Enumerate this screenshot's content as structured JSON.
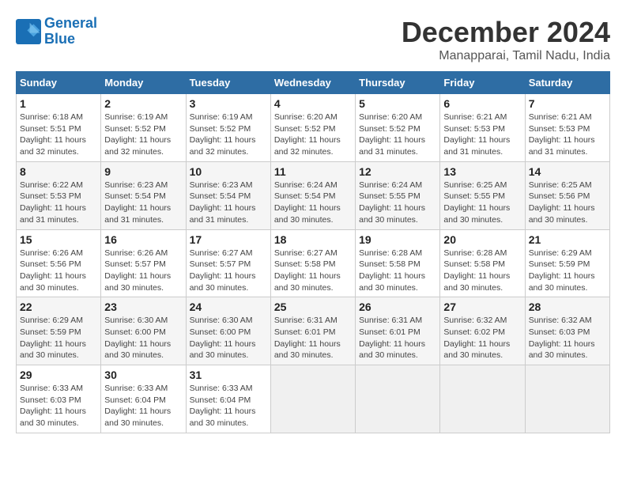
{
  "header": {
    "logo_line1": "General",
    "logo_line2": "Blue",
    "title": "December 2024",
    "subtitle": "Manapparai, Tamil Nadu, India"
  },
  "days_of_week": [
    "Sunday",
    "Monday",
    "Tuesday",
    "Wednesday",
    "Thursday",
    "Friday",
    "Saturday"
  ],
  "weeks": [
    [
      {
        "day": "1",
        "detail": "Sunrise: 6:18 AM\nSunset: 5:51 PM\nDaylight: 11 hours\nand 32 minutes."
      },
      {
        "day": "2",
        "detail": "Sunrise: 6:19 AM\nSunset: 5:52 PM\nDaylight: 11 hours\nand 32 minutes."
      },
      {
        "day": "3",
        "detail": "Sunrise: 6:19 AM\nSunset: 5:52 PM\nDaylight: 11 hours\nand 32 minutes."
      },
      {
        "day": "4",
        "detail": "Sunrise: 6:20 AM\nSunset: 5:52 PM\nDaylight: 11 hours\nand 32 minutes."
      },
      {
        "day": "5",
        "detail": "Sunrise: 6:20 AM\nSunset: 5:52 PM\nDaylight: 11 hours\nand 31 minutes."
      },
      {
        "day": "6",
        "detail": "Sunrise: 6:21 AM\nSunset: 5:53 PM\nDaylight: 11 hours\nand 31 minutes."
      },
      {
        "day": "7",
        "detail": "Sunrise: 6:21 AM\nSunset: 5:53 PM\nDaylight: 11 hours\nand 31 minutes."
      }
    ],
    [
      {
        "day": "8",
        "detail": "Sunrise: 6:22 AM\nSunset: 5:53 PM\nDaylight: 11 hours\nand 31 minutes."
      },
      {
        "day": "9",
        "detail": "Sunrise: 6:23 AM\nSunset: 5:54 PM\nDaylight: 11 hours\nand 31 minutes."
      },
      {
        "day": "10",
        "detail": "Sunrise: 6:23 AM\nSunset: 5:54 PM\nDaylight: 11 hours\nand 31 minutes."
      },
      {
        "day": "11",
        "detail": "Sunrise: 6:24 AM\nSunset: 5:54 PM\nDaylight: 11 hours\nand 30 minutes."
      },
      {
        "day": "12",
        "detail": "Sunrise: 6:24 AM\nSunset: 5:55 PM\nDaylight: 11 hours\nand 30 minutes."
      },
      {
        "day": "13",
        "detail": "Sunrise: 6:25 AM\nSunset: 5:55 PM\nDaylight: 11 hours\nand 30 minutes."
      },
      {
        "day": "14",
        "detail": "Sunrise: 6:25 AM\nSunset: 5:56 PM\nDaylight: 11 hours\nand 30 minutes."
      }
    ],
    [
      {
        "day": "15",
        "detail": "Sunrise: 6:26 AM\nSunset: 5:56 PM\nDaylight: 11 hours\nand 30 minutes."
      },
      {
        "day": "16",
        "detail": "Sunrise: 6:26 AM\nSunset: 5:57 PM\nDaylight: 11 hours\nand 30 minutes."
      },
      {
        "day": "17",
        "detail": "Sunrise: 6:27 AM\nSunset: 5:57 PM\nDaylight: 11 hours\nand 30 minutes."
      },
      {
        "day": "18",
        "detail": "Sunrise: 6:27 AM\nSunset: 5:58 PM\nDaylight: 11 hours\nand 30 minutes."
      },
      {
        "day": "19",
        "detail": "Sunrise: 6:28 AM\nSunset: 5:58 PM\nDaylight: 11 hours\nand 30 minutes."
      },
      {
        "day": "20",
        "detail": "Sunrise: 6:28 AM\nSunset: 5:58 PM\nDaylight: 11 hours\nand 30 minutes."
      },
      {
        "day": "21",
        "detail": "Sunrise: 6:29 AM\nSunset: 5:59 PM\nDaylight: 11 hours\nand 30 minutes."
      }
    ],
    [
      {
        "day": "22",
        "detail": "Sunrise: 6:29 AM\nSunset: 5:59 PM\nDaylight: 11 hours\nand 30 minutes."
      },
      {
        "day": "23",
        "detail": "Sunrise: 6:30 AM\nSunset: 6:00 PM\nDaylight: 11 hours\nand 30 minutes."
      },
      {
        "day": "24",
        "detail": "Sunrise: 6:30 AM\nSunset: 6:00 PM\nDaylight: 11 hours\nand 30 minutes."
      },
      {
        "day": "25",
        "detail": "Sunrise: 6:31 AM\nSunset: 6:01 PM\nDaylight: 11 hours\nand 30 minutes."
      },
      {
        "day": "26",
        "detail": "Sunrise: 6:31 AM\nSunset: 6:01 PM\nDaylight: 11 hours\nand 30 minutes."
      },
      {
        "day": "27",
        "detail": "Sunrise: 6:32 AM\nSunset: 6:02 PM\nDaylight: 11 hours\nand 30 minutes."
      },
      {
        "day": "28",
        "detail": "Sunrise: 6:32 AM\nSunset: 6:03 PM\nDaylight: 11 hours\nand 30 minutes."
      }
    ],
    [
      {
        "day": "29",
        "detail": "Sunrise: 6:33 AM\nSunset: 6:03 PM\nDaylight: 11 hours\nand 30 minutes."
      },
      {
        "day": "30",
        "detail": "Sunrise: 6:33 AM\nSunset: 6:04 PM\nDaylight: 11 hours\nand 30 minutes."
      },
      {
        "day": "31",
        "detail": "Sunrise: 6:33 AM\nSunset: 6:04 PM\nDaylight: 11 hours\nand 30 minutes."
      },
      {
        "day": "",
        "detail": ""
      },
      {
        "day": "",
        "detail": ""
      },
      {
        "day": "",
        "detail": ""
      },
      {
        "day": "",
        "detail": ""
      }
    ]
  ]
}
